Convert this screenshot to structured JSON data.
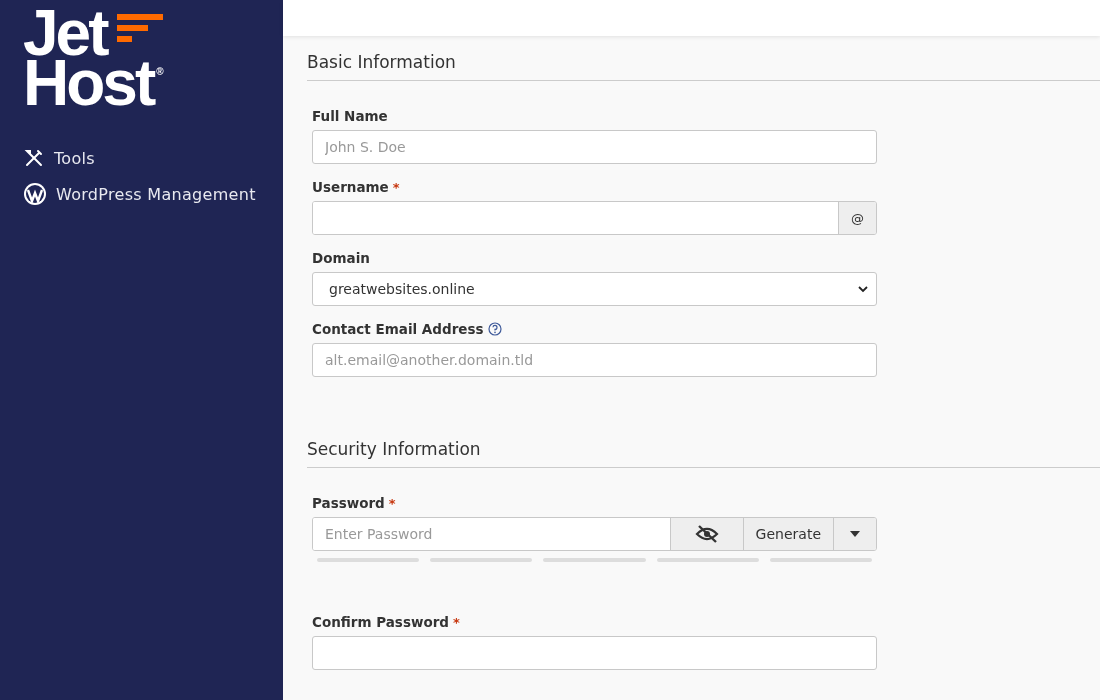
{
  "logo": {
    "line_1": "Jet",
    "line_2": "Host",
    "mark": "®"
  },
  "sidebar": {
    "items": [
      {
        "label": "Tools"
      },
      {
        "label": "WordPress Management"
      }
    ]
  },
  "sections": [
    {
      "title": "Basic Information",
      "fields": [
        {
          "kind": "text",
          "label": "Full Name",
          "help": false,
          "placeholder": "John S. Doe"
        },
        {
          "kind": "addon",
          "label": "Username",
          "required_mark": "*",
          "help": false,
          "addon": "@"
        },
        {
          "kind": "select",
          "label": "Domain",
          "help": false,
          "value": "greatwebsites.online"
        },
        {
          "kind": "text",
          "label": "Contact Email Address",
          "help": true,
          "placeholder": "alt.email@another.domain.tld"
        }
      ]
    },
    {
      "title": "Security Information",
      "fields": [
        {
          "kind": "password",
          "label": "Password",
          "required_mark": "*",
          "help": false,
          "placeholder": "Enter Password",
          "generate": "Generate"
        },
        {
          "kind": "text",
          "label": "Confirm Password",
          "required_mark": "*",
          "help": false
        }
      ]
    }
  ]
}
